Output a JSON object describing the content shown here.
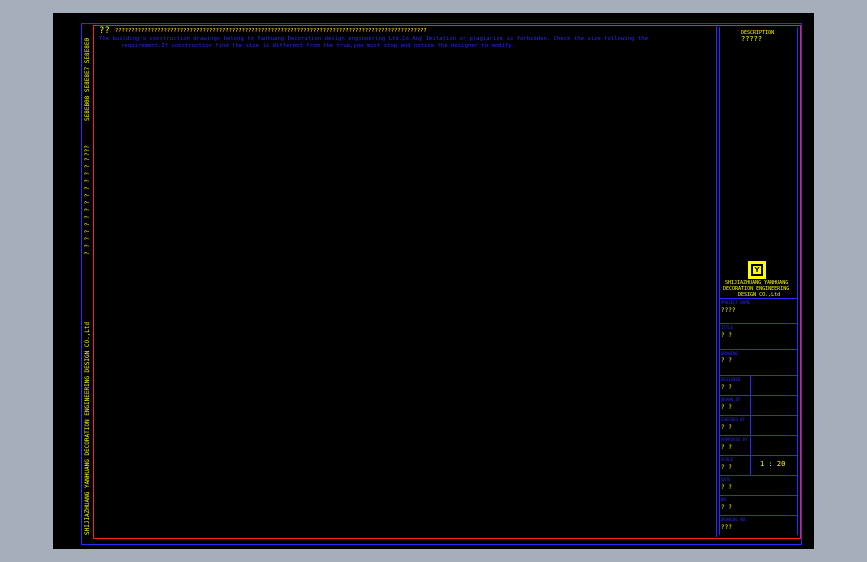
{
  "colors": {
    "background": "#000000",
    "frame_outer": "#2a2aff",
    "frame_inner": "#ff2020",
    "text": "#ffff00",
    "note": "#2a2aff"
  },
  "header": {
    "mark": "??",
    "title_line": "????????????????????????????????????????????????????????????????????????????????????????????????",
    "note_1": "The building's construction drawings belong to Yanhuang Decoration design engineering Ltd.Co.Any Imitation or plagiarize is forbidden. Check the size following the",
    "note_2": "requirement.If construction find the size is different from the true,you must stop and notice the designer to modify."
  },
  "left_strip": {
    "text_1": "SE8EB08 SE8E8E7 SE8E8E0",
    "text_2": "???",
    "text_3": "? ? ? ? ? ? ? ? ? ? ? ? ? ?",
    "text_4": "SHIJIAZHUANG YANHUANG DECORATION ENGINEERING DESIGN CO.,Ltd"
  },
  "title_block": {
    "description_label": "DESCRIPTION",
    "description_value": "?????",
    "logo_letter": "Y",
    "company_1": "SHIJIAZHUANG YANHUANG",
    "company_2": "DECORATION ENGINEERING",
    "company_3": "DESIGN CO.,Ltd",
    "rows": [
      {
        "label": "PROJECT NAME",
        "value": "????"
      },
      {
        "label": "TITLE",
        "value": "? ?"
      },
      {
        "label": "DRAWING",
        "value": "? ?"
      },
      {
        "label": "DESIGNED",
        "value": "? ?"
      },
      {
        "label": "DRAWN BY",
        "value": "? ?"
      },
      {
        "label": "CHECKED BY",
        "value": "? ?"
      },
      {
        "label": "APPROVED BY",
        "value": "? ?"
      },
      {
        "label": "SCALE",
        "value": "? ?"
      },
      {
        "label": "DATE",
        "value": "? ?"
      },
      {
        "label": "NO.",
        "value": "? ?"
      },
      {
        "label": "DRAWING NO.",
        "value": "???"
      }
    ],
    "scale_value": "1 : 20"
  }
}
